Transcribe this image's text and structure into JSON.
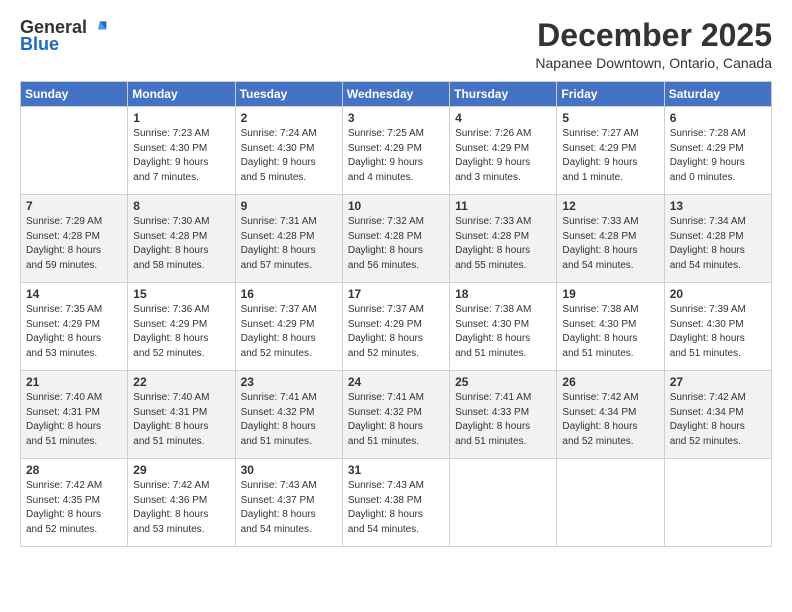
{
  "logo": {
    "general": "General",
    "blue": "Blue"
  },
  "header": {
    "month_year": "December 2025",
    "location": "Napanee Downtown, Ontario, Canada"
  },
  "days_of_week": [
    "Sunday",
    "Monday",
    "Tuesday",
    "Wednesday",
    "Thursday",
    "Friday",
    "Saturday"
  ],
  "weeks": [
    [
      {
        "day": "",
        "info": ""
      },
      {
        "day": "1",
        "info": "Sunrise: 7:23 AM\nSunset: 4:30 PM\nDaylight: 9 hours\nand 7 minutes."
      },
      {
        "day": "2",
        "info": "Sunrise: 7:24 AM\nSunset: 4:30 PM\nDaylight: 9 hours\nand 5 minutes."
      },
      {
        "day": "3",
        "info": "Sunrise: 7:25 AM\nSunset: 4:29 PM\nDaylight: 9 hours\nand 4 minutes."
      },
      {
        "day": "4",
        "info": "Sunrise: 7:26 AM\nSunset: 4:29 PM\nDaylight: 9 hours\nand 3 minutes."
      },
      {
        "day": "5",
        "info": "Sunrise: 7:27 AM\nSunset: 4:29 PM\nDaylight: 9 hours\nand 1 minute."
      },
      {
        "day": "6",
        "info": "Sunrise: 7:28 AM\nSunset: 4:29 PM\nDaylight: 9 hours\nand 0 minutes."
      }
    ],
    [
      {
        "day": "7",
        "info": "Sunrise: 7:29 AM\nSunset: 4:28 PM\nDaylight: 8 hours\nand 59 minutes."
      },
      {
        "day": "8",
        "info": "Sunrise: 7:30 AM\nSunset: 4:28 PM\nDaylight: 8 hours\nand 58 minutes."
      },
      {
        "day": "9",
        "info": "Sunrise: 7:31 AM\nSunset: 4:28 PM\nDaylight: 8 hours\nand 57 minutes."
      },
      {
        "day": "10",
        "info": "Sunrise: 7:32 AM\nSunset: 4:28 PM\nDaylight: 8 hours\nand 56 minutes."
      },
      {
        "day": "11",
        "info": "Sunrise: 7:33 AM\nSunset: 4:28 PM\nDaylight: 8 hours\nand 55 minutes."
      },
      {
        "day": "12",
        "info": "Sunrise: 7:33 AM\nSunset: 4:28 PM\nDaylight: 8 hours\nand 54 minutes."
      },
      {
        "day": "13",
        "info": "Sunrise: 7:34 AM\nSunset: 4:28 PM\nDaylight: 8 hours\nand 54 minutes."
      }
    ],
    [
      {
        "day": "14",
        "info": "Sunrise: 7:35 AM\nSunset: 4:29 PM\nDaylight: 8 hours\nand 53 minutes."
      },
      {
        "day": "15",
        "info": "Sunrise: 7:36 AM\nSunset: 4:29 PM\nDaylight: 8 hours\nand 52 minutes."
      },
      {
        "day": "16",
        "info": "Sunrise: 7:37 AM\nSunset: 4:29 PM\nDaylight: 8 hours\nand 52 minutes."
      },
      {
        "day": "17",
        "info": "Sunrise: 7:37 AM\nSunset: 4:29 PM\nDaylight: 8 hours\nand 52 minutes."
      },
      {
        "day": "18",
        "info": "Sunrise: 7:38 AM\nSunset: 4:30 PM\nDaylight: 8 hours\nand 51 minutes."
      },
      {
        "day": "19",
        "info": "Sunrise: 7:38 AM\nSunset: 4:30 PM\nDaylight: 8 hours\nand 51 minutes."
      },
      {
        "day": "20",
        "info": "Sunrise: 7:39 AM\nSunset: 4:30 PM\nDaylight: 8 hours\nand 51 minutes."
      }
    ],
    [
      {
        "day": "21",
        "info": "Sunrise: 7:40 AM\nSunset: 4:31 PM\nDaylight: 8 hours\nand 51 minutes."
      },
      {
        "day": "22",
        "info": "Sunrise: 7:40 AM\nSunset: 4:31 PM\nDaylight: 8 hours\nand 51 minutes."
      },
      {
        "day": "23",
        "info": "Sunrise: 7:41 AM\nSunset: 4:32 PM\nDaylight: 8 hours\nand 51 minutes."
      },
      {
        "day": "24",
        "info": "Sunrise: 7:41 AM\nSunset: 4:32 PM\nDaylight: 8 hours\nand 51 minutes."
      },
      {
        "day": "25",
        "info": "Sunrise: 7:41 AM\nSunset: 4:33 PM\nDaylight: 8 hours\nand 51 minutes."
      },
      {
        "day": "26",
        "info": "Sunrise: 7:42 AM\nSunset: 4:34 PM\nDaylight: 8 hours\nand 52 minutes."
      },
      {
        "day": "27",
        "info": "Sunrise: 7:42 AM\nSunset: 4:34 PM\nDaylight: 8 hours\nand 52 minutes."
      }
    ],
    [
      {
        "day": "28",
        "info": "Sunrise: 7:42 AM\nSunset: 4:35 PM\nDaylight: 8 hours\nand 52 minutes."
      },
      {
        "day": "29",
        "info": "Sunrise: 7:42 AM\nSunset: 4:36 PM\nDaylight: 8 hours\nand 53 minutes."
      },
      {
        "day": "30",
        "info": "Sunrise: 7:43 AM\nSunset: 4:37 PM\nDaylight: 8 hours\nand 54 minutes."
      },
      {
        "day": "31",
        "info": "Sunrise: 7:43 AM\nSunset: 4:38 PM\nDaylight: 8 hours\nand 54 minutes."
      },
      {
        "day": "",
        "info": ""
      },
      {
        "day": "",
        "info": ""
      },
      {
        "day": "",
        "info": ""
      }
    ]
  ]
}
